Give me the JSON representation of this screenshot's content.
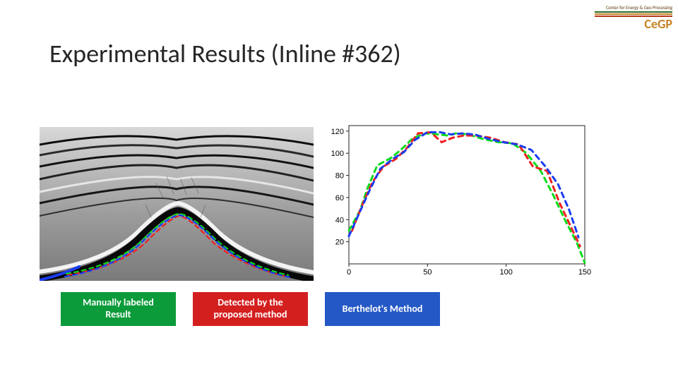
{
  "logo": {
    "top_text": "Center for Energy & Geo Processing",
    "main": "CeGP",
    "bar_colors": [
      "#2a6a2a",
      "#c58427",
      "#b33a1a"
    ]
  },
  "title": "Experimental Results (Inline #362)",
  "legend": [
    {
      "label": "Manually labeled\nResult",
      "bg": "#0b9b3a"
    },
    {
      "label": "Detected by the\nproposed method",
      "bg": "#d41f1f"
    },
    {
      "label": "Berthelot's Method",
      "bg": "#2458c6"
    }
  ],
  "chart_data": {
    "type": "line",
    "title": "",
    "xlabel": "",
    "ylabel": "",
    "xlim": [
      0,
      150
    ],
    "ylim": [
      0,
      125
    ],
    "xticks": [
      0,
      50,
      100,
      150
    ],
    "yticks": [
      20,
      40,
      60,
      80,
      100,
      120
    ],
    "line_style": "dashed",
    "series": [
      {
        "name": "Manually labeled Result",
        "color": "#0bdc1c",
        "x": [
          0,
          7,
          12,
          18,
          27,
          33,
          41,
          49,
          57,
          63,
          68,
          76,
          85,
          95,
          104,
          113,
          122,
          130,
          138,
          145,
          150
        ],
        "y": [
          30,
          48,
          69,
          89,
          96,
          103,
          114,
          118,
          117,
          116,
          118,
          117,
          113,
          110,
          109,
          100,
          84,
          62,
          38,
          19,
          1
        ]
      },
      {
        "name": "Detected by the proposed method",
        "color": "#ef2020",
        "x": [
          2,
          9,
          15,
          22,
          30,
          37,
          44,
          52,
          59,
          66,
          73,
          81,
          90,
          99,
          108,
          117,
          126,
          134,
          141,
          147
        ],
        "y": [
          30,
          55,
          74,
          88,
          95,
          105,
          118,
          119,
          110,
          114,
          116,
          116,
          114,
          110,
          108,
          88,
          84,
          55,
          34,
          16
        ]
      },
      {
        "name": "Berthelot's Method",
        "color": "#1a3cf0",
        "x": [
          0,
          6,
          13,
          20,
          28,
          35,
          42,
          50,
          58,
          65,
          72,
          80,
          89,
          98,
          107,
          116,
          125,
          133,
          140,
          146
        ],
        "y": [
          25,
          44,
          66,
          86,
          95,
          101,
          112,
          119,
          119,
          117,
          118,
          117,
          113,
          110,
          108,
          103,
          88,
          72,
          49,
          24
        ]
      }
    ]
  }
}
